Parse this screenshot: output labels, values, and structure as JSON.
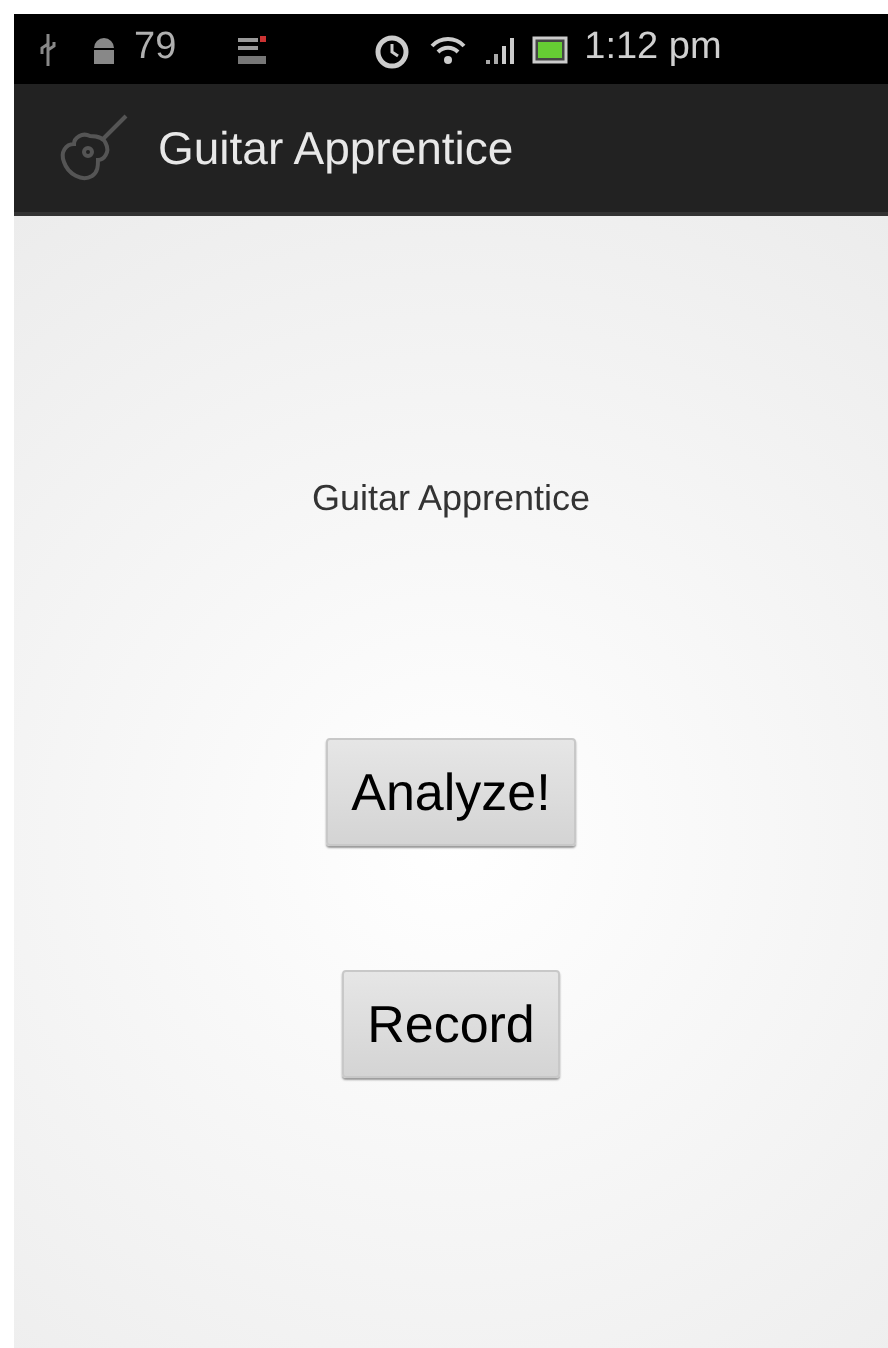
{
  "status_bar": {
    "notification_count": "79",
    "time": "1:12 pm"
  },
  "action_bar": {
    "title": "Guitar Apprentice"
  },
  "content": {
    "label": "Guitar Apprentice",
    "buttons": [
      {
        "label": "Analyze!"
      },
      {
        "label": "Record"
      }
    ]
  }
}
